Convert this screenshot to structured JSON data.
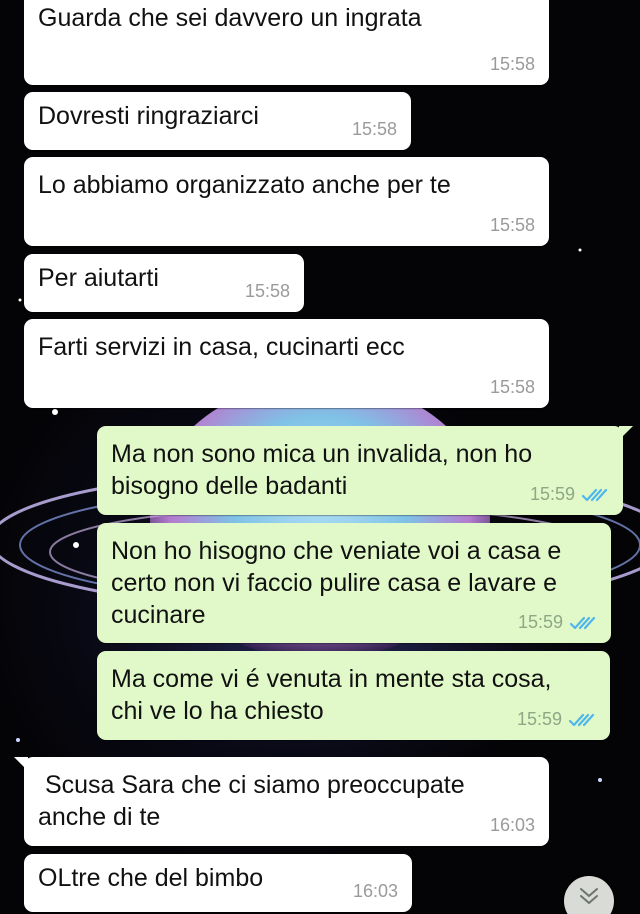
{
  "messages": [
    {
      "direction": "incoming",
      "text": "Guarda che sei davvero un ingrata",
      "time": "15:58"
    },
    {
      "direction": "incoming",
      "text": "Dovresti ringraziarci",
      "time": "15:58"
    },
    {
      "direction": "incoming",
      "text": "Lo abbiamo organizzato anche per te",
      "time": "15:58"
    },
    {
      "direction": "incoming",
      "text": "Per aiutarti",
      "time": "15:58"
    },
    {
      "direction": "incoming",
      "text": "Farti servizi in casa, cucinarti ecc",
      "time": "15:58"
    },
    {
      "direction": "outgoing",
      "text": "Ma non sono mica un invalida, non ho\nbisogno delle badanti",
      "time": "15:59",
      "status": "read"
    },
    {
      "direction": "outgoing",
      "text": "Non ho hisogno che veniate voi a casa e\ncerto non vi faccio pulire casa e lavare e\ncucinare",
      "time": "15:59",
      "status": "read"
    },
    {
      "direction": "outgoing",
      "text": "Ma come vi é venuta in mente sta cosa,\nchi ve lo ha chiesto",
      "time": "15:59",
      "status": "read"
    },
    {
      "direction": "incoming",
      "text": " Scusa Sara che ci siamo preoccupate\nanche di te",
      "time": "16:03"
    },
    {
      "direction": "incoming",
      "text": "OLtre che del bimbo",
      "time": "16:03"
    }
  ],
  "colors": {
    "incoming_bubble": "#ffffff",
    "outgoing_bubble": "#e1f9c8",
    "read_ticks": "#4fb6ec",
    "background": "#050507"
  },
  "icons": {
    "read_receipt": "double-check-icon",
    "scroll_down": "chevron-double-down-icon"
  }
}
